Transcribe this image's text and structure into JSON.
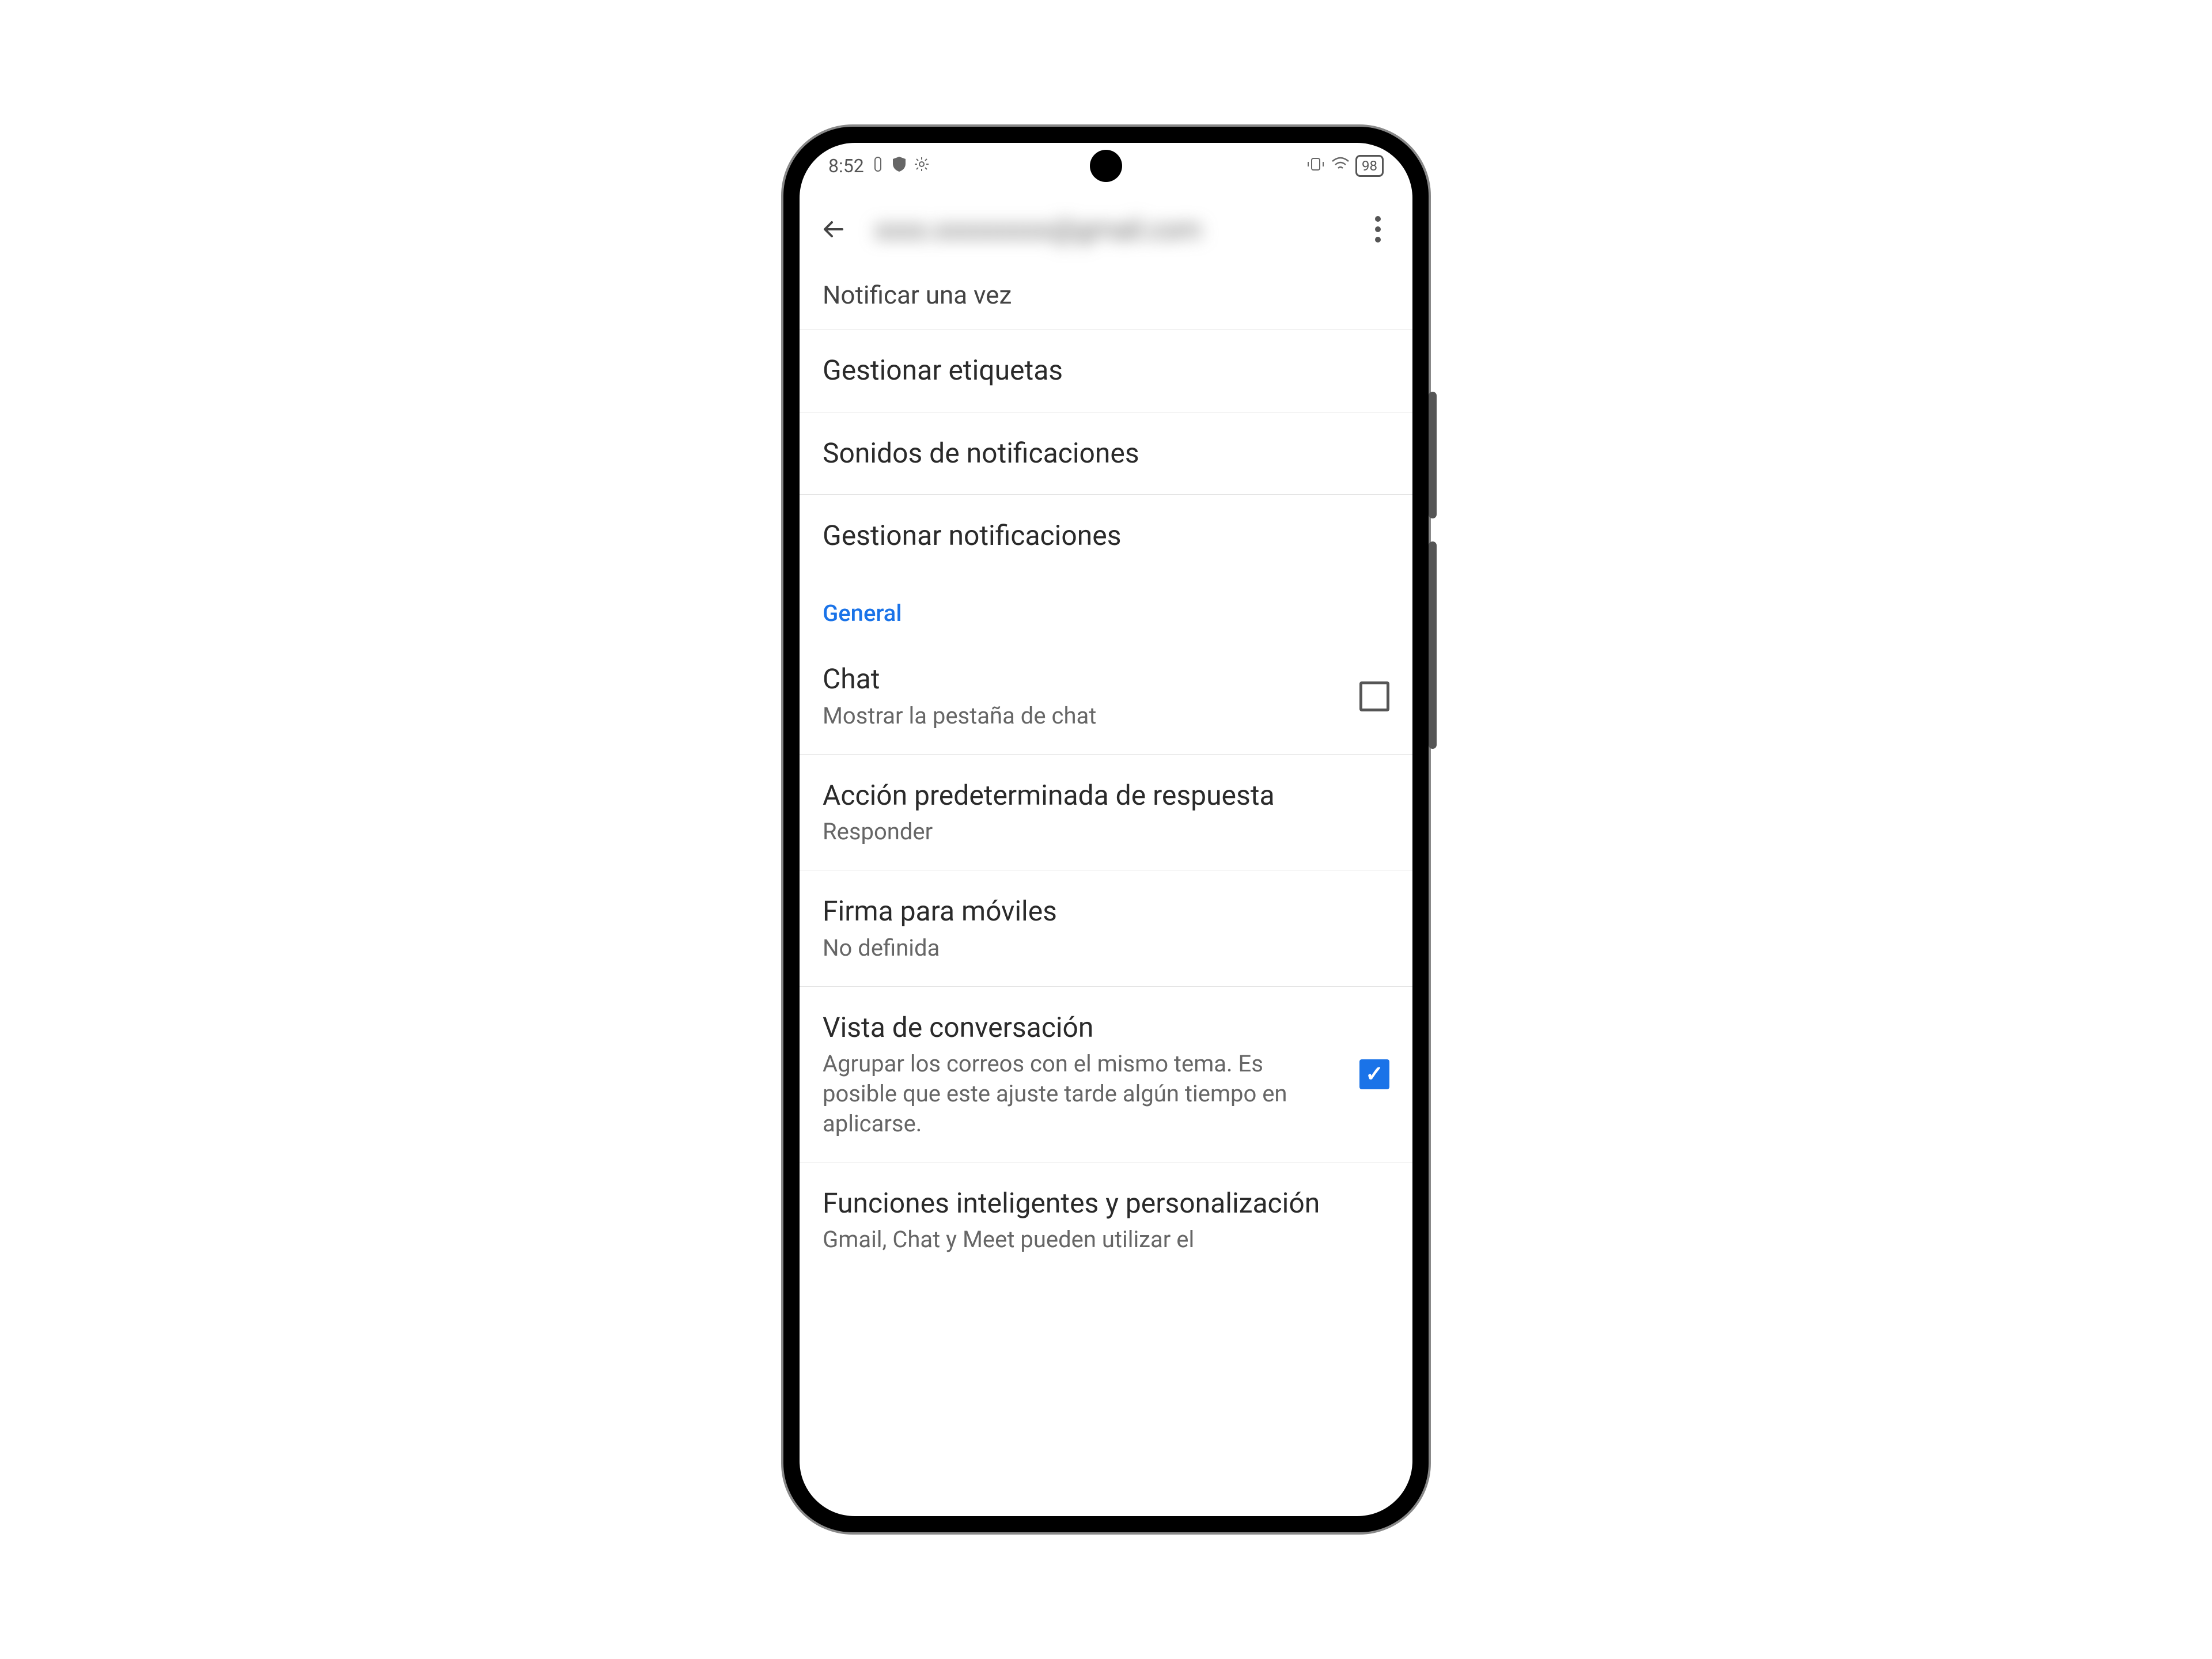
{
  "status": {
    "time": "8:52",
    "battery": "98"
  },
  "appbar": {
    "title_blurred": "xxxx.xxxxxxxxx@gmail.com"
  },
  "items": {
    "notify_once": "Notificar una vez",
    "manage_labels": "Gestionar etiquetas",
    "notification_sounds": "Sonidos de notificaciones",
    "manage_notifications": "Gestionar notificaciones"
  },
  "section_general": "General",
  "general": {
    "chat_title": "Chat",
    "chat_subtitle": "Mostrar la pestaña de chat",
    "chat_checked": false,
    "reply_action_title": "Acción predeterminada de respuesta",
    "reply_action_subtitle": "Responder",
    "signature_title": "Firma para móviles",
    "signature_subtitle": "No definida",
    "conversation_title": "Vista de conversación",
    "conversation_subtitle": "Agrupar los correos con el mismo tema. Es posible que este ajuste tarde algún tiempo en aplicarse.",
    "conversation_checked": true,
    "smart_title": "Funciones inteligentes y personalización",
    "smart_subtitle": "Gmail, Chat y Meet pueden utilizar el"
  }
}
